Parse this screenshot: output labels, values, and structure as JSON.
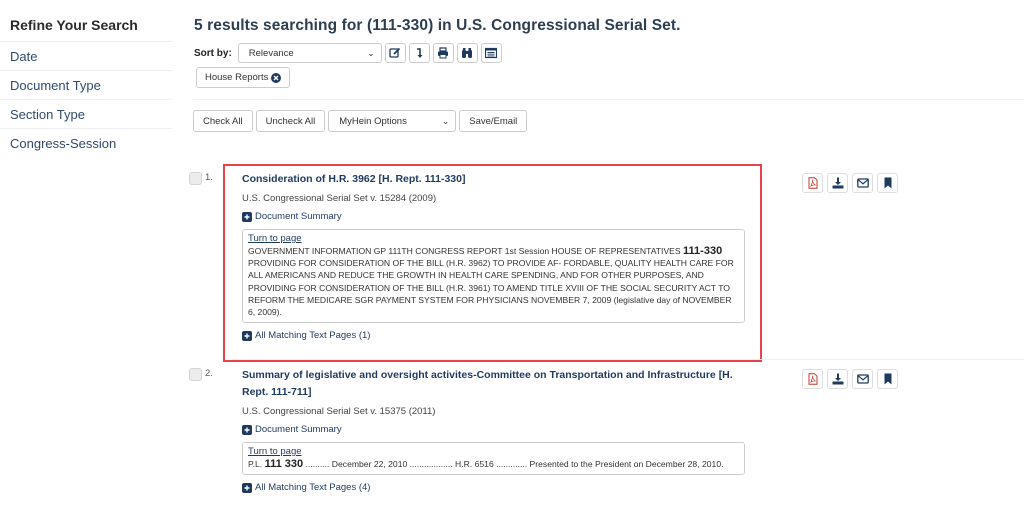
{
  "sidebar": {
    "title": "Refine Your Search",
    "items": [
      {
        "label": "Date"
      },
      {
        "label": "Document Type"
      },
      {
        "label": "Section Type"
      },
      {
        "label": "Congress-Session"
      }
    ]
  },
  "header": {
    "results_title": "5 results searching for (111-330) in U.S. Congressional Serial Set."
  },
  "sort": {
    "label": "Sort by:",
    "selected": "Relevance",
    "tools": [
      {
        "icon": "edit-icon"
      },
      {
        "icon": "sort-arrow-icon"
      },
      {
        "icon": "print-icon"
      },
      {
        "icon": "binoculars-icon"
      },
      {
        "icon": "list-view-icon"
      }
    ]
  },
  "filters": [
    {
      "label": "House Reports"
    }
  ],
  "actions": {
    "check_all": "Check All",
    "uncheck_all": "Uncheck All",
    "myhein_options": "MyHein Options",
    "save_email": "Save/Email"
  },
  "results": [
    {
      "number": "1.",
      "title": "Consideration of H.R. 3962 [H. Rept. 111-330]",
      "meta": "U.S. Congressional Serial Set v. 15284 (2009)",
      "summary_label": "Document Summary",
      "turn_to_page": "Turn to page",
      "snippet_before": "GOVERNMENT INFORMATION GP 111TH CONGRESS REPORT 1st Session HOUSE OF REPRESENTATIVES ",
      "snippet_hit": "111-330",
      "snippet_after": " PROVIDING FOR CONSIDERATION OF THE BILL (H.R. 3962) TO PROVIDE AF- FORDABLE, QUALITY HEALTH CARE FOR ALL AMERICANS AND REDUCE THE GROWTH IN HEALTH CARE SPENDING, AND FOR OTHER PURPOSES, AND PROVIDING FOR CONSIDERATION OF THE BILL (H.R. 3961) TO AMEND TITLE XVIII OF THE SOCIAL SECURITY ACT TO REFORM THE MEDICARE SGR PAYMENT SYSTEM FOR PHYSICIANS NOVEMBER 7, 2009 (legislative day of NOVEMBER 6, 2009).",
      "matching_pages": "All Matching Text Pages (1)"
    },
    {
      "number": "2.",
      "title": "Summary of legislative and oversight activites-Committee on Transportation and Infrastructure [H. Rept. 111-711]",
      "meta": "U.S. Congressional Serial Set v. 15375 (2011)",
      "summary_label": "Document Summary",
      "turn_to_page": "Turn to page",
      "snippet_before": "P.L. ",
      "snippet_hit": "111 330",
      "snippet_after": " .......... December 22, 2010 .................. H.R. 6516 ............. Presented to the President on December 28, 2010.",
      "matching_pages": "All Matching Text Pages (4)"
    }
  ],
  "result_actions": [
    {
      "icon": "pdf-icon"
    },
    {
      "icon": "download-icon"
    },
    {
      "icon": "email-icon"
    },
    {
      "icon": "bookmark-icon"
    }
  ],
  "colors": {
    "brand_navy": "#1f3a5f",
    "highlight_border": "#e8434a",
    "pdf_red": "#c0392b"
  }
}
